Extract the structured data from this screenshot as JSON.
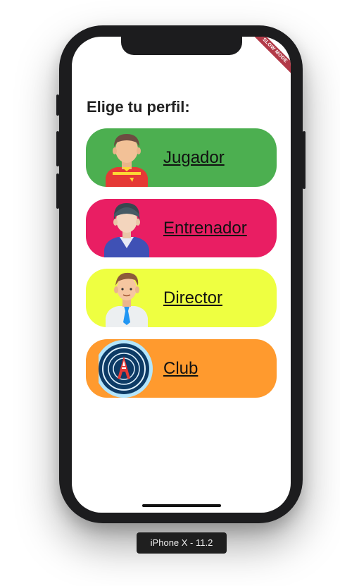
{
  "screen": {
    "title": "Elige tu perfil:",
    "debug_banner": "SLOW MODE"
  },
  "profiles": [
    {
      "label": "Jugador",
      "color": "#4CAF50",
      "icon": "soccer-player-icon"
    },
    {
      "label": "Entrenador",
      "color": "#E91E63",
      "icon": "coach-icon"
    },
    {
      "label": "Director",
      "color": "#EEFF41",
      "icon": "director-icon"
    },
    {
      "label": "Club",
      "color": "#FF9A2E",
      "icon": "club-crest-icon"
    }
  ],
  "device": {
    "label": "iPhone X - 11.2"
  }
}
